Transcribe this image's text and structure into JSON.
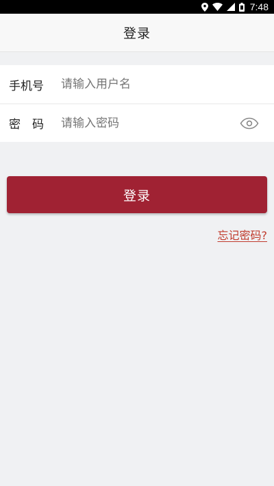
{
  "status_bar": {
    "time": "7:48",
    "icons": [
      "location-icon",
      "wifi-icon",
      "signal-icon",
      "battery-icon"
    ]
  },
  "app_bar": {
    "title": "登录"
  },
  "form": {
    "phone": {
      "label": "手机号",
      "placeholder": "请输入用户名",
      "value": ""
    },
    "password": {
      "label": "密码",
      "placeholder": "请输入密码",
      "value": ""
    }
  },
  "actions": {
    "login_label": "登录",
    "forgot_label": "忘记密码?"
  },
  "colors": {
    "accent": "#a02233",
    "link": "#c0392b",
    "background": "#f0f1f3"
  }
}
